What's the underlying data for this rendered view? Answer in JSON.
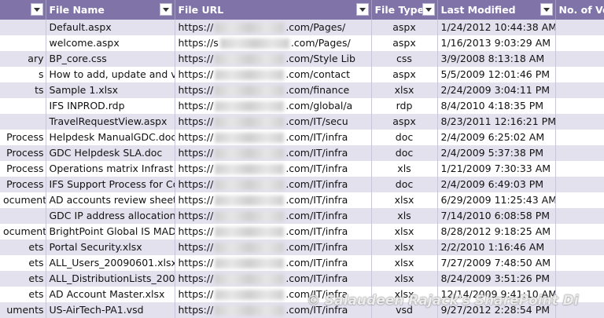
{
  "headers": [
    "",
    "File Name",
    "File URL",
    "File Type",
    "Last Modified",
    "No. of Ve"
  ],
  "rows": [
    {
      "title": "",
      "name": "Default.aspx",
      "url_pre": "https://",
      "url_post": ".com/Pages/",
      "type": "aspx",
      "modified": "1/24/2012 10:44:38 AM"
    },
    {
      "title": "",
      "name": "welcome.aspx",
      "url_pre": "https://s",
      "url_post": ".com/Pages/",
      "type": "aspx",
      "modified": "1/16/2013 9:03:29 AM"
    },
    {
      "title": "ary",
      "name": "BP_core.css",
      "url_pre": "https://",
      "url_post": ".com/Style Lib",
      "type": "css",
      "modified": "3/9/2008 8:13:18 AM"
    },
    {
      "title": "s",
      "name": "How to add, update and v",
      "url_pre": "https://",
      "url_post": ".com/contact",
      "type": "aspx",
      "modified": "5/5/2009 12:01:46 PM"
    },
    {
      "title": "ts",
      "name": "Sample 1.xlsx",
      "url_pre": "https://",
      "url_post": ".com/finance",
      "type": "xlsx",
      "modified": "2/24/2009 3:04:11 PM"
    },
    {
      "title": "",
      "name": "IFS INPROD.rdp",
      "url_pre": "https://",
      "url_post": ".com/global/a",
      "type": "rdp",
      "modified": "8/4/2010 4:18:35 PM"
    },
    {
      "title": "",
      "name": "TravelRequestView.aspx",
      "url_pre": "https://",
      "url_post": ".com/IT/secu",
      "type": "aspx",
      "modified": "8/23/2011 12:16:21 PM"
    },
    {
      "title": "Process",
      "name": "Helpdesk ManualGDC.doc",
      "url_pre": "https://",
      "url_post": ".com/IT/infra",
      "type": "doc",
      "modified": "2/4/2009 6:25:02 AM"
    },
    {
      "title": "Process",
      "name": "GDC Helpdesk SLA.doc",
      "url_pre": "https://",
      "url_post": ".com/IT/infra",
      "type": "doc",
      "modified": "2/4/2009 5:37:38 PM"
    },
    {
      "title": "Process",
      "name": "Operations matrix Infrast",
      "url_pre": "https://",
      "url_post": ".com/IT/infra",
      "type": "xls",
      "modified": "1/21/2009 7:30:33 AM"
    },
    {
      "title": "Process",
      "name": "IFS Support Process for Co",
      "url_pre": "https://",
      "url_post": ".com/IT/infra",
      "type": "doc",
      "modified": "2/4/2009 6:49:03 PM"
    },
    {
      "title": "ocuments",
      "name": "AD accounts review sheet",
      "url_pre": "https://",
      "url_post": ".com/IT/infra",
      "type": "xlsx",
      "modified": "6/29/2009 11:25:43 AM"
    },
    {
      "title": "",
      "name": "GDC IP address allocation",
      "url_pre": "https://",
      "url_post": ".com/IT/infra",
      "type": "xls",
      "modified": "7/14/2010 6:08:58 PM"
    },
    {
      "title": "ocuments",
      "name": "BrightPoint Global IS MAD",
      "url_pre": "https://",
      "url_post": ".com/IT/infra",
      "type": "xlsx",
      "modified": "8/28/2012 9:18:25 AM"
    },
    {
      "title": "ets",
      "name": "Portal Security.xlsx",
      "url_pre": "https://",
      "url_post": ".com/IT/infra",
      "type": "xlsx",
      "modified": "2/2/2010 1:16:46 AM"
    },
    {
      "title": "ets",
      "name": "ALL_Users_20090601.xlsx",
      "url_pre": "https://",
      "url_post": ".com/IT/infra",
      "type": "xlsx",
      "modified": "7/27/2009 7:48:50 AM"
    },
    {
      "title": "ets",
      "name": "ALL_DistributionLists_200",
      "url_pre": "https://",
      "url_post": ".com/IT/infra",
      "type": "xlsx",
      "modified": "8/24/2009 3:51:26 PM"
    },
    {
      "title": "ets",
      "name": "AD Account Master.xlsx",
      "url_pre": "https://",
      "url_post": ".com/IT/infra",
      "type": "xlsx",
      "modified": "12/14/2009 9:41:10 AM"
    },
    {
      "title": "uments",
      "name": "US-AirTech-PA1.vsd",
      "url_pre": "https://",
      "url_post": ".com/IT/infra",
      "type": "vsd",
      "modified": "9/27/2012 2:28:54 PM"
    }
  ],
  "watermark": "© Salaudeen Rajack's SharePoint Di"
}
